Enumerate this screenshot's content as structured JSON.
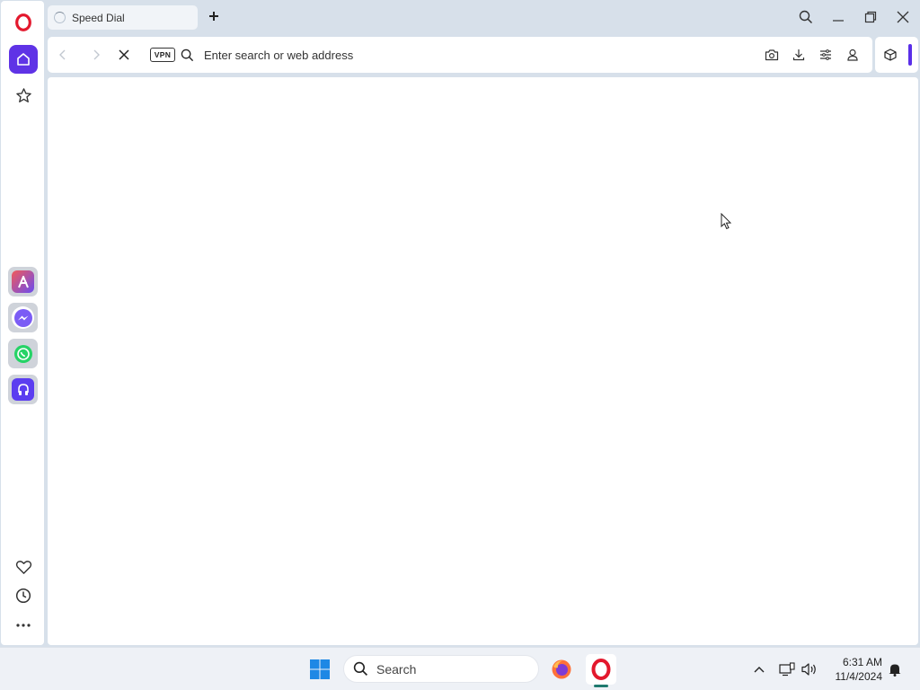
{
  "browser": {
    "tab": {
      "title": "Speed Dial",
      "loading": true
    },
    "new_tab_icon": "plus-icon",
    "window_controls": [
      "search-icon",
      "minimize-icon",
      "restore-icon",
      "close-icon"
    ]
  },
  "toolbar": {
    "vpn_label": "VPN",
    "address_placeholder": "Enter search or web address",
    "address_value": "",
    "icons": [
      "back-icon",
      "forward-icon",
      "stop-loading-icon",
      "search-icon",
      "snapshot-icon",
      "download-icon",
      "easy-setup-icon",
      "profile-icon",
      "extensions-icon"
    ]
  },
  "sidebar": {
    "items": [
      {
        "name": "opera-logo-icon"
      },
      {
        "name": "home-icon",
        "active": true
      },
      {
        "name": "pinboards-icon"
      },
      {
        "name": "aria-app-icon"
      },
      {
        "name": "messenger-app-icon"
      },
      {
        "name": "whatsapp-app-icon"
      },
      {
        "name": "music-player-app-icon"
      },
      {
        "name": "bookmarks-heart-icon"
      },
      {
        "name": "history-icon"
      },
      {
        "name": "more-icon"
      }
    ]
  },
  "taskbar": {
    "search_placeholder": "Search",
    "apps": [
      "windows-start-icon",
      "firefox-icon",
      "opera-icon"
    ],
    "tray": [
      "chevron-up-icon",
      "network-icon",
      "volume-icon",
      "notification-bell-icon"
    ],
    "time": "6:31 AM",
    "date": "11/4/2024"
  },
  "colors": {
    "accent": "#5f33e6",
    "opera_red": "#e3182d",
    "frame": "#d7e0ea"
  }
}
